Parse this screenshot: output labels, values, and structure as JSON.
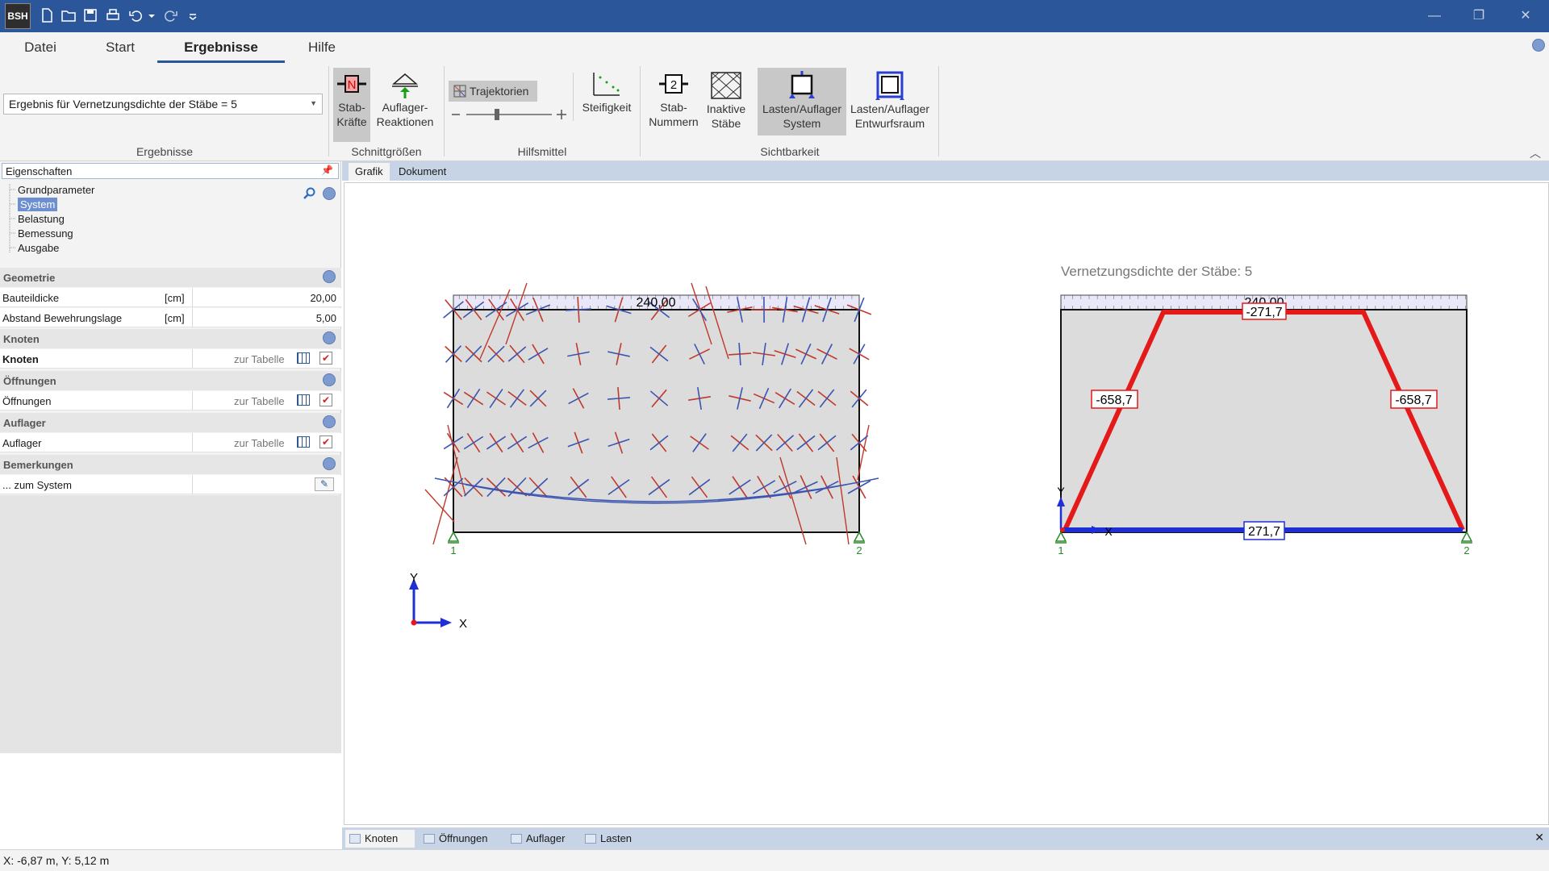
{
  "app": {
    "logo": "BSH"
  },
  "menu": {
    "tabs": [
      "Datei",
      "Start",
      "Ergebnisse",
      "Hilfe"
    ],
    "active": "Ergebnisse"
  },
  "ribbon": {
    "result_select": "Ergebnis für Vernetzungsdichte der Stäbe = 5",
    "groups": {
      "ergebnisse": "Ergebnisse",
      "schnittgroessen": "Schnittgrößen",
      "hilfsmittel": "Hilfsmittel",
      "sichtbarkeit": "Sichtbarkeit"
    },
    "buttons": {
      "stabkraefte": [
        "Stab-",
        "Kräfte"
      ],
      "auflager_reaktionen": [
        "Auflager-",
        "Reaktionen"
      ],
      "trajektorien": "Trajektorien",
      "steifigkeit": "Steifigkeit",
      "stab_nummern": [
        "Stab-",
        "Nummern"
      ],
      "inaktive_staebe": [
        "Inaktive",
        "Stäbe"
      ],
      "lasten_system": [
        "Lasten/Auflager",
        "System"
      ],
      "lasten_entwurfsraum": [
        "Lasten/Auflager",
        "Entwurfsraum"
      ]
    },
    "icons": {
      "stabkraefte": "N",
      "stab_nummern": "2"
    }
  },
  "properties": {
    "header": "Eigenschaften",
    "tree": [
      "Grundparameter",
      "System",
      "Belastung",
      "Bemessung",
      "Ausgabe"
    ],
    "tree_selected": "System",
    "sections": {
      "geometrie": "Geometrie",
      "knoten": "Knoten",
      "oeffnungen": "Öffnungen",
      "auflager": "Auflager",
      "bemerkungen": "Bemerkungen"
    },
    "rows": {
      "bauteildicke": {
        "label": "Bauteildicke",
        "unit": "[cm]",
        "value": "20,00"
      },
      "bewehrungslage": {
        "label": "Abstand Bewehrungslage",
        "unit": "[cm]",
        "value": "5,00"
      },
      "knoten": {
        "label": "Knoten",
        "link": "zur Tabelle"
      },
      "oeffnungen": {
        "label": "Öffnungen",
        "link": "zur Tabelle"
      },
      "auflager": {
        "label": "Auflager",
        "link": "zur Tabelle"
      },
      "bemerkung": {
        "label": "... zum System"
      }
    }
  },
  "doc_tabs": [
    "Grafik",
    "Dokument"
  ],
  "canvas": {
    "left_load": "240,00",
    "right_title": "Vernetzungsdichte der Stäbe: 5",
    "right_load": "240,00",
    "forces": {
      "top": "-271,7",
      "left": "-658,7",
      "right": "-658,7",
      "bottom": "271,7"
    },
    "support_labels": [
      "1",
      "2"
    ],
    "axis_x": "X",
    "axis_y": "Y",
    "colors": {
      "compression": "#e41a1a",
      "tension": "#1f2fd6",
      "traj_red": "#c0392b",
      "traj_blue": "#3b54b0"
    }
  },
  "bottom_tabs": [
    "Knoten",
    "Öffnungen",
    "Auflager",
    "Lasten"
  ],
  "status": {
    "coords": "X: -6,87 m, Y: 5,12 m"
  }
}
